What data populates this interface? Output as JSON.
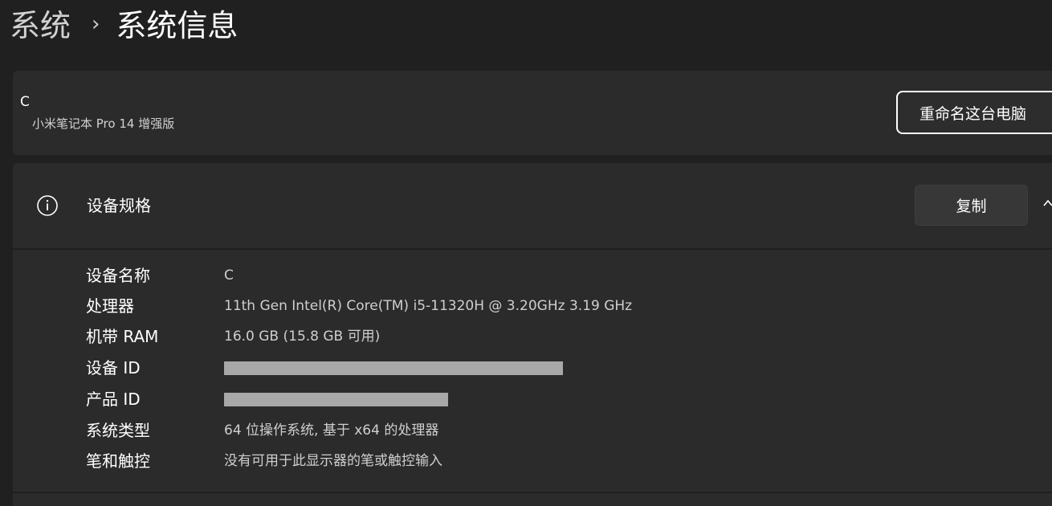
{
  "breadcrumb": {
    "parent": "系统",
    "separator": "›",
    "current": "系统信息"
  },
  "device": {
    "name": "C",
    "model": "小米笔记本 Pro 14 增强版",
    "rename_label": "重命名这台电脑"
  },
  "specs": {
    "icon": "info-icon",
    "title": "设备规格",
    "copy_label": "复制",
    "collapse_icon": "chevron-up-icon",
    "rows": [
      {
        "label": "设备名称",
        "value": "C"
      },
      {
        "label": "处理器",
        "value": "11th Gen Intel(R) Core(TM) i5-11320H @ 3.20GHz   3.19 GHz"
      },
      {
        "label": "机带 RAM",
        "value": "16.0 GB (15.8 GB 可用)"
      },
      {
        "label": "设备 ID",
        "value": ""
      },
      {
        "label": "产品 ID",
        "value": ""
      },
      {
        "label": "系统类型",
        "value": "64 位操作系统, 基于 x64 的处理器"
      },
      {
        "label": "笔和触控",
        "value": "没有可用于此显示器的笔或触控输入"
      }
    ]
  },
  "colors": {
    "background": "#202020",
    "card": "#2b2b2b",
    "button": "#373737",
    "redaction": "#a8a8a8"
  }
}
